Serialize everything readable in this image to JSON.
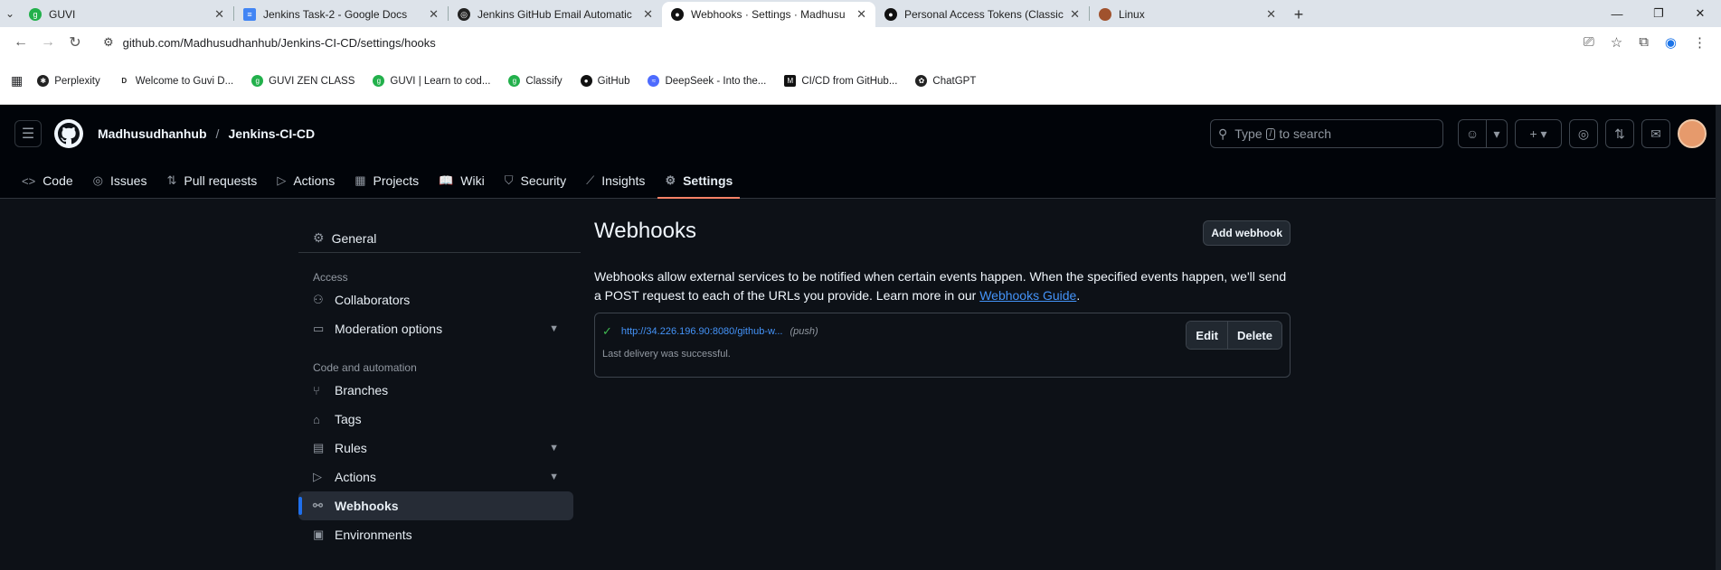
{
  "browser": {
    "tabs": [
      {
        "title": "GUVI",
        "active": false,
        "favicon_color": "#22b04b"
      },
      {
        "title": "Jenkins Task-2 - Google Docs",
        "active": false,
        "favicon_color": "#4285f4"
      },
      {
        "title": "Jenkins GitHub Email Automatic",
        "active": false,
        "favicon_color": "#222"
      },
      {
        "title": "Webhooks · Settings · Madhusu",
        "active": true,
        "favicon_color": "#111"
      },
      {
        "title": "Personal Access Tokens (Classic",
        "active": false,
        "favicon_color": "#111"
      },
      {
        "title": "Linux",
        "active": false,
        "favicon_color": "#a0522d"
      }
    ],
    "url": "github.com/Madhusudhanhub/Jenkins-CI-CD/settings/hooks",
    "bookmarks": [
      {
        "label": "Perplexity",
        "color": "#222"
      },
      {
        "label": "Welcome to Guvi D...",
        "color": "#444"
      },
      {
        "label": "GUVI ZEN CLASS",
        "color": "#22b04b"
      },
      {
        "label": "GUVI | Learn to cod...",
        "color": "#22b04b"
      },
      {
        "label": "Classify",
        "color": "#22b04b"
      },
      {
        "label": "GitHub",
        "color": "#111"
      },
      {
        "label": "DeepSeek - Into the...",
        "color": "#4d6bfe"
      },
      {
        "label": "CI/CD from GitHub...",
        "color": "#111"
      },
      {
        "label": "ChatGPT",
        "color": "#222"
      }
    ]
  },
  "header": {
    "owner": "Madhusudhanhub",
    "separator": "/",
    "repo": "Jenkins-CI-CD",
    "search_placeholder_pre": "Type",
    "search_key": "/",
    "search_placeholder_post": "to search"
  },
  "repo_nav": [
    {
      "label": "Code",
      "icon": "<>"
    },
    {
      "label": "Issues",
      "icon": "◎"
    },
    {
      "label": "Pull requests",
      "icon": "⇅"
    },
    {
      "label": "Actions",
      "icon": "▷"
    },
    {
      "label": "Projects",
      "icon": "▦"
    },
    {
      "label": "Wiki",
      "icon": "📖"
    },
    {
      "label": "Security",
      "icon": "⛉"
    },
    {
      "label": "Insights",
      "icon": "⟋"
    },
    {
      "label": "Settings",
      "icon": "⚙"
    }
  ],
  "sidebar": {
    "general": "General",
    "access_heading": "Access",
    "collaborators": "Collaborators",
    "moderation": "Moderation options",
    "code_heading": "Code and automation",
    "branches": "Branches",
    "tags": "Tags",
    "rules": "Rules",
    "actions": "Actions",
    "webhooks": "Webhooks",
    "environments": "Environments"
  },
  "main": {
    "title": "Webhooks",
    "add_button": "Add webhook",
    "description": "Webhooks allow external services to be notified when certain events happen. When the specified events happen, we'll send a POST request to each of the URLs you provide. Learn more in our ",
    "guide_link": "Webhooks Guide",
    "description_end": ".",
    "hook": {
      "url": "http://34.226.196.90:8080/github-w...",
      "events": "(push)",
      "status": "Last delivery was successful.",
      "edit": "Edit",
      "delete": "Delete"
    }
  }
}
